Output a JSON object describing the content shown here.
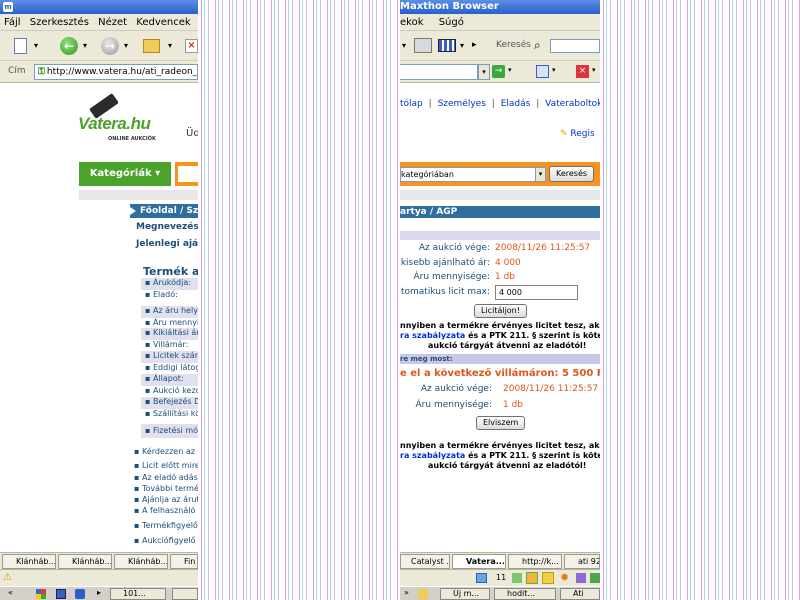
{
  "window": {
    "title_left": "",
    "title_right": "Maxthon Browser"
  },
  "menu": {
    "left": [
      "Fájl",
      "Szerkesztés",
      "Nézet",
      "Kedvencek"
    ],
    "right": [
      "ekok",
      "Súgó"
    ]
  },
  "toolbar": {
    "search_label": "Keresés"
  },
  "address": {
    "label": "Cím",
    "url": "http://www.vatera.hu/ati_radeon_"
  },
  "site": {
    "logo_text": "Vatera.hu",
    "logo_sub": "ONLINE AUKCIÓK",
    "greeting": "Üdv",
    "nav_links": [
      "tólap",
      "Személyes",
      "Eladás",
      "Vateraboltok"
    ],
    "register": "Regis",
    "categories_button": "Kategóriák ▾",
    "category_select": "kategóriában",
    "search_button": "Keresés",
    "breadcrumb_left": "Főoldal / Sz",
    "breadcrumb_right": "artya / AGP",
    "field_name": "Megnevezés:",
    "field_current": "Jelenlegi ajánla",
    "section_title": "Termék ada",
    "detail_rows": [
      "Árukódja:",
      "Eladó:",
      "Az áru helye",
      "Áru mennyis",
      "Kikiáltási ár:",
      "Villámár:",
      "Licitek szám",
      "Eddigi látoga",
      "Állapot:",
      "Aukció kezd",
      "Befejezés D",
      "Szállítási költ",
      "Fizetési mód"
    ],
    "bullet_links": [
      "Kérdezzen az e",
      "Licit előtt mire üg",
      "Az eladó adásv",
      "További terméke",
      "Ajánlja az árut b",
      "A felhasználó e",
      "Termékfigyelő",
      "Aukciófigyelő"
    ],
    "auction_end_label": "Az aukció vége:",
    "auction_end_value": "2008/11/26 11:25:57",
    "min_bid_label": "gkisebb ajánlható ár:",
    "min_bid_value": "4 000",
    "qty_label": "Áru mennyisége:",
    "qty_value": "1 db",
    "autobid_label": "utomatikus licit max:",
    "autobid_input": "4 000",
    "bid_button": "Licitáljon!",
    "legal1_line1": "nnyiben a termékre érvényes licitet tesz, akk",
    "legal1_line2a": "ra szabályzata",
    "legal1_line2b": " és a PTK 211. § szerint is kötele",
    "legal1_line3": "aukció tárgyát átvenni az eladótól!",
    "buy_now_strip": "re meg most:",
    "buy_now_headline": "e el a következő villámáron: 5 500 Ft",
    "buy_end_label": "Az aukció vége:",
    "buy_end_value": "2008/11/26 11:25:57",
    "buy_qty_label": "Áru mennyisége:",
    "buy_qty_value": "1 db",
    "buy_button": "Elviszem",
    "legal2_line1": "nnyiben a termékre érvényes licitet tesz, akk",
    "legal2_line2a": "ra szabályzata",
    "legal2_line2b": " és a PTK 211. § szerint is kötele",
    "legal2_line3": "aukció tárgyát átvenni az eladótól!"
  },
  "tabs": {
    "left": [
      "Klánháb...",
      "Klánháb...",
      "Klánháb...",
      "Fin"
    ],
    "right": [
      "Catalyst ...",
      "Vatera...",
      "http://k...",
      "ati 92"
    ]
  },
  "status": {
    "count": "11"
  },
  "taskbar": {
    "left": [
      "101...",
      ""
    ],
    "right": [
      "Új m...",
      "hodit...",
      "Ati"
    ]
  },
  "colors": {
    "xp_blue": "#2a5fc9",
    "vatera_green": "#4aa32b",
    "vatera_orange": "#f7941d",
    "vatera_header": "#2f6f9f",
    "price_orange": "#e0561b"
  }
}
